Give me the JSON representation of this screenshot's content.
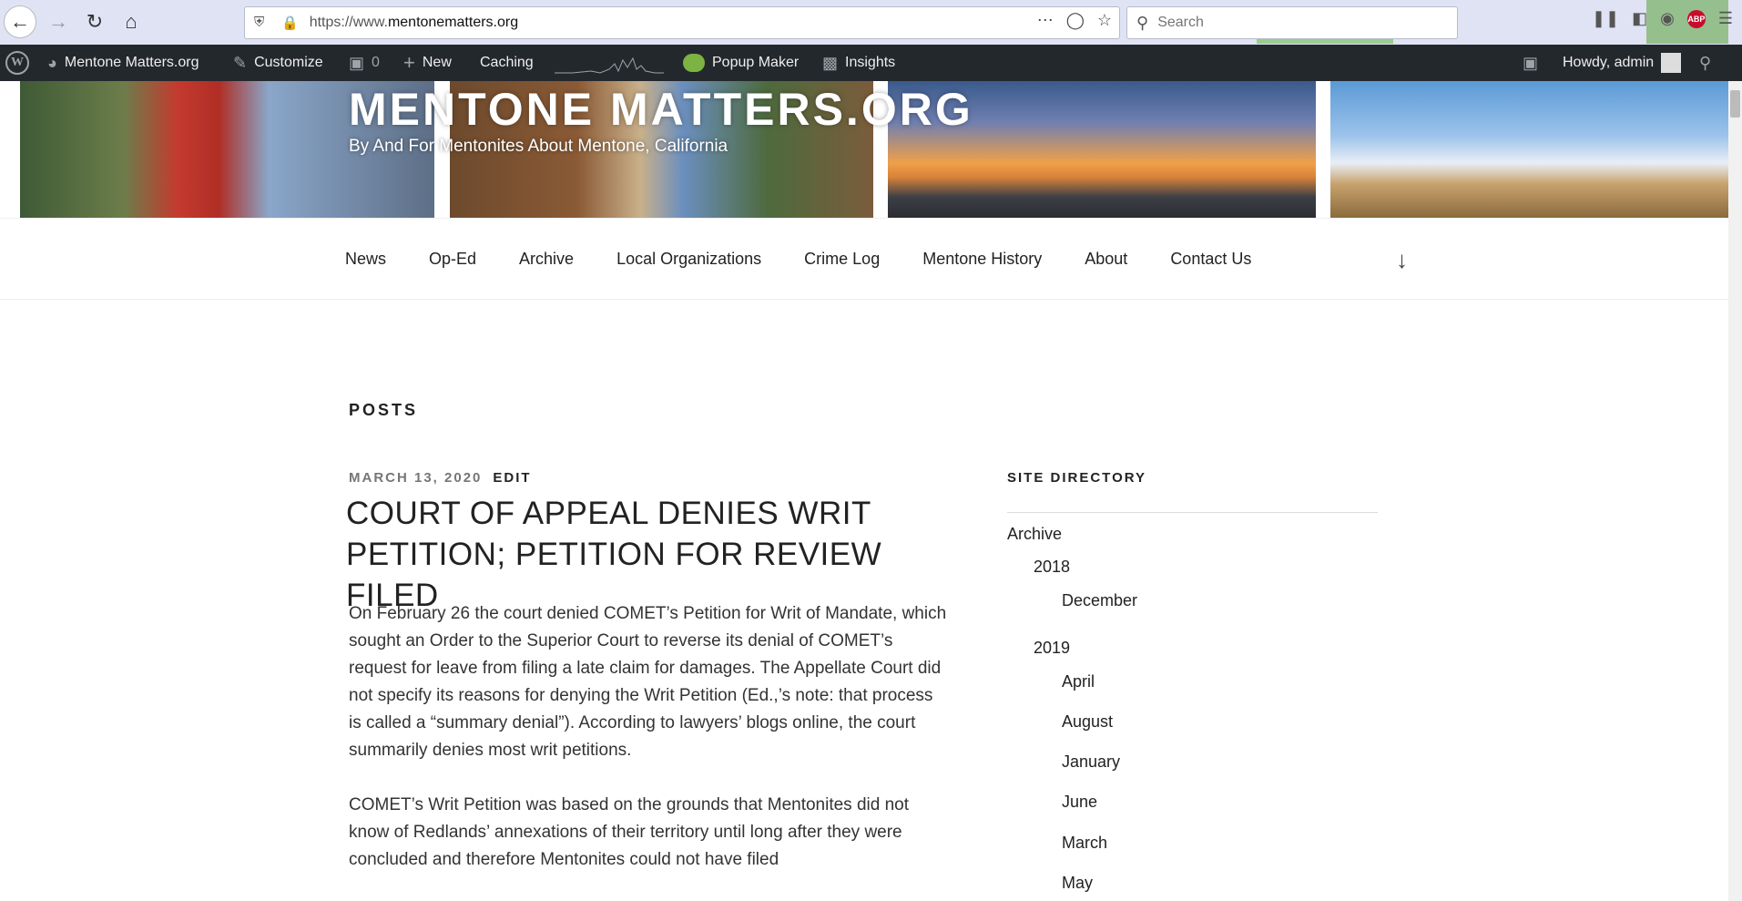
{
  "browser": {
    "url_prefix": "https://www.",
    "url_domain": "mentonematters.org",
    "search_placeholder": "Search",
    "abp_label": "ABP"
  },
  "admin_bar": {
    "site_name": "Mentone Matters.org",
    "customize": "Customize",
    "comments_count": "0",
    "new": "New",
    "caching": "Caching",
    "popup_maker": "Popup Maker",
    "insights": "Insights",
    "howdy": "Howdy, admin"
  },
  "header": {
    "site_title": "MENTONE MATTERS.ORG",
    "site_description": "By And For Mentonites About Mentone, California"
  },
  "nav": {
    "items": [
      "News",
      "Op-Ed",
      "Archive",
      "Local Organizations",
      "Crime Log",
      "Mentone History",
      "About",
      "Contact Us"
    ]
  },
  "content": {
    "section_heading": "POSTS",
    "post": {
      "date": "MARCH 13, 2020",
      "edit": "EDIT",
      "title": "COURT OF APPEAL DENIES WRIT PETITION; PETITION FOR REVIEW FILED",
      "paragraphs": [
        "On February 26 the court denied COMET’s Petition for Writ of Mandate, which sought an Order to the Superior Court to reverse its denial of COMET’s request for leave from filing a late claim for damages. The Appellate Court did not specify its reasons for denying the Writ Petition (Ed.,’s note: that process is called a “summary denial”). According to lawyers’ blogs online, the court summarily denies most writ petitions.",
        "COMET’s Writ Petition was based on the grounds that Mentonites did not know of Redlands’ annexations of their territory until long after they were concluded and therefore Mentonites could not have filed"
      ]
    }
  },
  "sidebar": {
    "title": "SITE DIRECTORY",
    "archive": "Archive",
    "year_2018": "2018",
    "months_2018": [
      "December"
    ],
    "year_2019": "2019",
    "months_2019": [
      "April",
      "August",
      "January",
      "June",
      "March",
      "May"
    ]
  }
}
